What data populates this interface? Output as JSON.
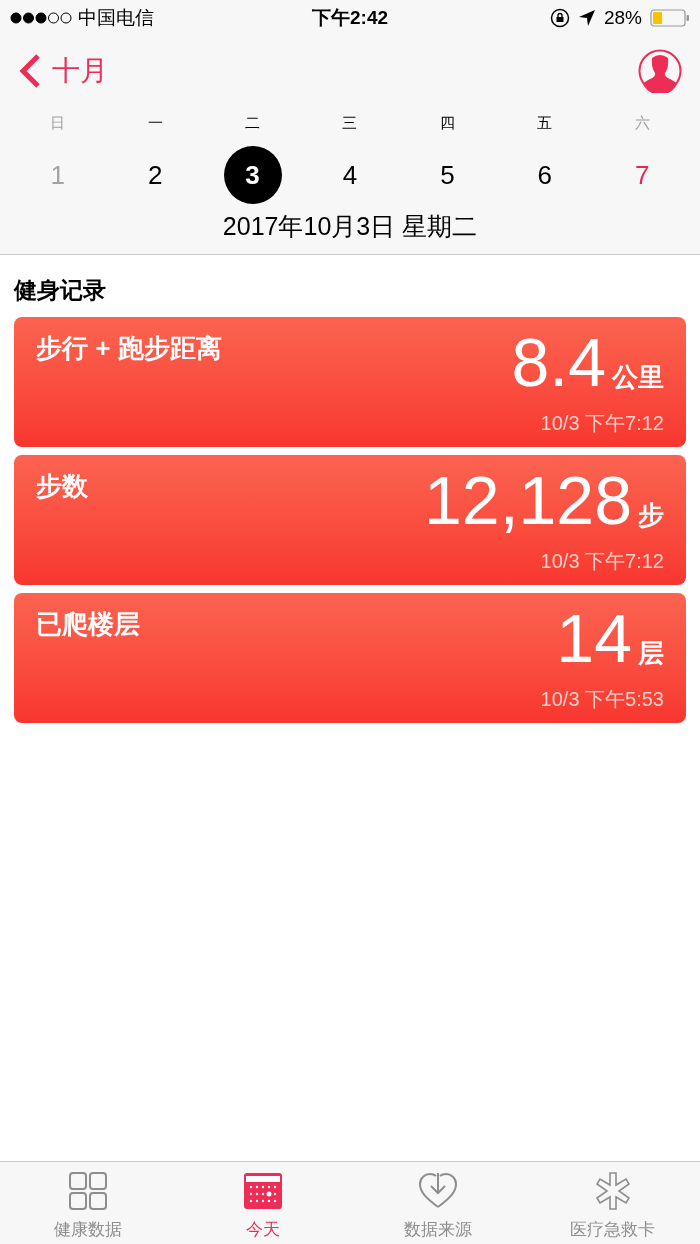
{
  "status_bar": {
    "carrier": "中国电信",
    "time": "下午2:42",
    "battery": "28%"
  },
  "nav": {
    "back": "十月"
  },
  "week": {
    "weekdays": [
      {
        "label": "日",
        "muted": true
      },
      {
        "label": "一",
        "muted": false
      },
      {
        "label": "二",
        "muted": false
      },
      {
        "label": "三",
        "muted": false
      },
      {
        "label": "四",
        "muted": false
      },
      {
        "label": "五",
        "muted": false
      },
      {
        "label": "六",
        "muted": true
      }
    ],
    "days": [
      {
        "label": "1",
        "selected": false,
        "color": "#a3a3a3"
      },
      {
        "label": "2",
        "selected": false,
        "color": "#000000"
      },
      {
        "label": "3",
        "selected": true,
        "color": "#000000"
      },
      {
        "label": "4",
        "selected": false,
        "color": "#000000"
      },
      {
        "label": "5",
        "selected": false,
        "color": "#000000"
      },
      {
        "label": "6",
        "selected": false,
        "color": "#000000"
      },
      {
        "label": "7",
        "selected": false,
        "color": "#e8264f"
      }
    ],
    "date": "2017年10月3日 星期二"
  },
  "section": {
    "title": "健身记录",
    "cards": [
      {
        "title": "步行 + 跑步距离",
        "value": "8.4",
        "unit": "公里",
        "time": "10/3 下午7:12"
      },
      {
        "title": "步数",
        "value": "12,128",
        "unit": "步",
        "time": "10/3 下午7:12"
      },
      {
        "title": "已爬楼层",
        "value": "14",
        "unit": "层",
        "time": "10/3 下午5:53"
      }
    ]
  },
  "tabs": [
    {
      "label": "健康数据",
      "kind": "grid",
      "selected": false
    },
    {
      "label": "今天",
      "kind": "calendar",
      "selected": true
    },
    {
      "label": "数据来源",
      "kind": "heart",
      "selected": false
    },
    {
      "label": "医疗急救卡",
      "kind": "asterisk",
      "selected": false
    }
  ]
}
